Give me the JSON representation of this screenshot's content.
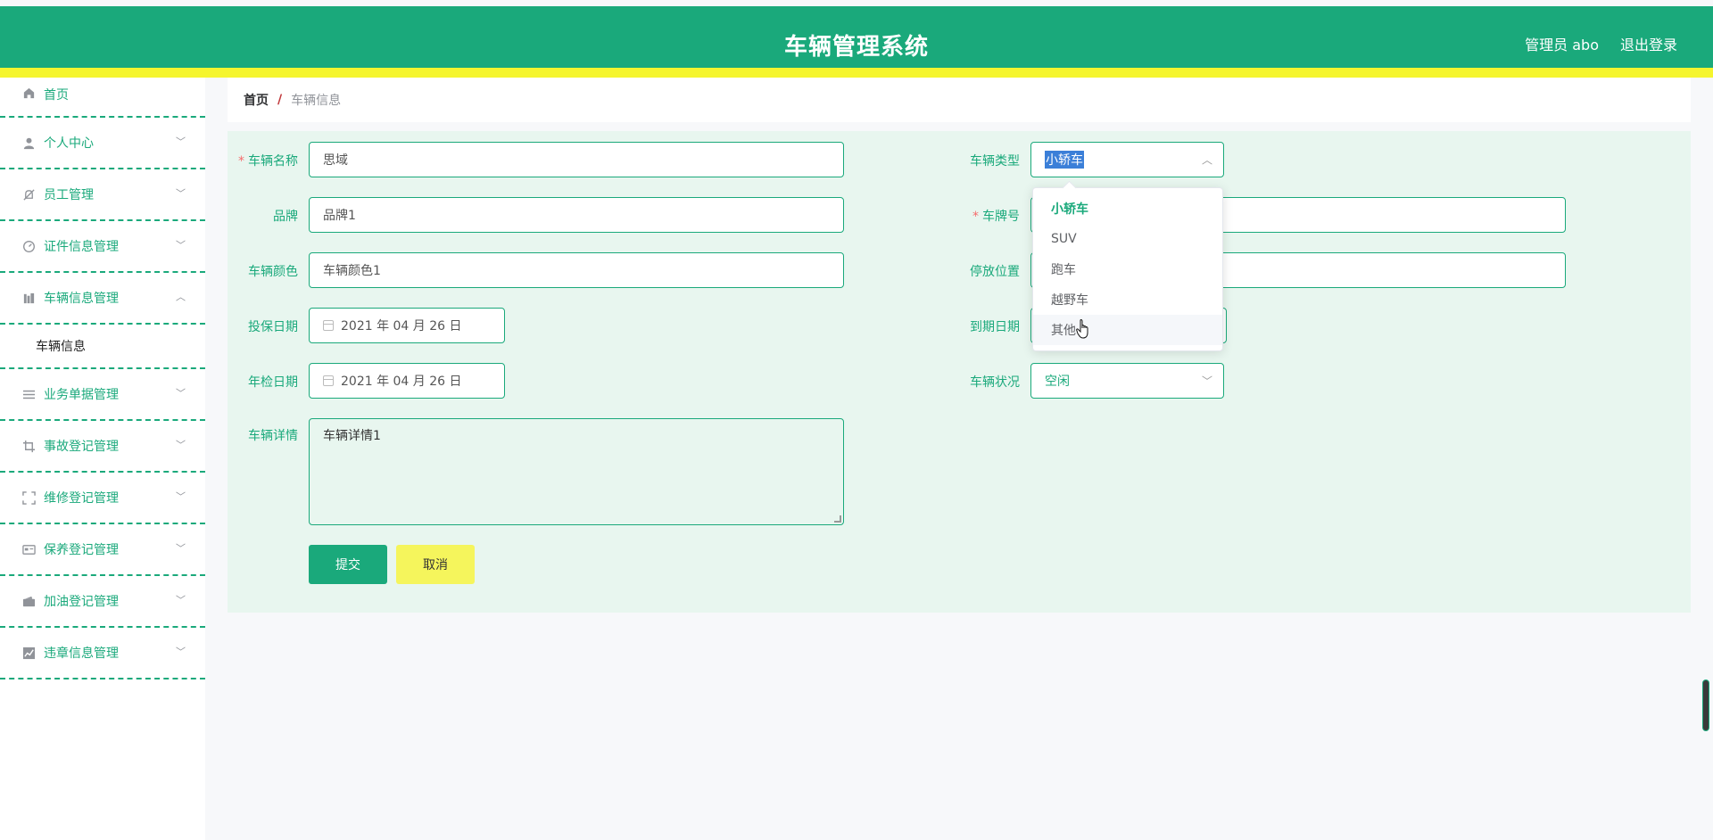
{
  "header": {
    "title": "车辆管理系统",
    "user": "管理员 abo",
    "logout": "退出登录"
  },
  "sidebar": {
    "items": [
      {
        "label": "首页",
        "icon": "home-icon"
      },
      {
        "label": "个人中心",
        "icon": "user-icon"
      },
      {
        "label": "员工管理",
        "icon": "bell-off-icon"
      },
      {
        "label": "证件信息管理",
        "icon": "gauge-icon"
      },
      {
        "label": "车辆信息管理",
        "icon": "building-icon"
      },
      {
        "label": "业务单据管理",
        "icon": "list-icon"
      },
      {
        "label": "事故登记管理",
        "icon": "crop-icon"
      },
      {
        "label": "维修登记管理",
        "icon": "fullscreen-icon"
      },
      {
        "label": "保养登记管理",
        "icon": "id-card-icon"
      },
      {
        "label": "加油登记管理",
        "icon": "wallet-icon"
      },
      {
        "label": "违章信息管理",
        "icon": "chart-icon"
      }
    ],
    "submenu": {
      "label": "车辆信息"
    }
  },
  "breadcrumb": {
    "home": "首页",
    "separator": "/",
    "current": "车辆信息"
  },
  "form": {
    "vehicle_name": {
      "label": "车辆名称",
      "value": "思域",
      "required": "*"
    },
    "brand": {
      "label": "品牌",
      "value": "品牌1"
    },
    "color": {
      "label": "车辆颜色",
      "value": "车辆颜色1"
    },
    "insure_date": {
      "label": "投保日期",
      "value": "2021 年 04 月 26 日"
    },
    "inspect_date": {
      "label": "年检日期",
      "value": "2021 年 04 月 26 日"
    },
    "details": {
      "label": "车辆详情",
      "value": "车辆详情1"
    },
    "vehicle_type": {
      "label": "车辆类型",
      "value": "小轿车"
    },
    "plate": {
      "label": "车牌号",
      "required": "*"
    },
    "parking": {
      "label": "停放位置"
    },
    "expire_date": {
      "label": "到期日期"
    },
    "status": {
      "label": "车辆状况",
      "value": "空闲"
    },
    "submit": "提交",
    "cancel": "取消"
  },
  "dropdown": {
    "options": [
      "小轿车",
      "SUV",
      "跑车",
      "越野车",
      "其他"
    ],
    "selected": "小轿车",
    "hovered": "其他"
  },
  "colors": {
    "primary": "#1aa97b",
    "accent": "#f5f52e",
    "form_bg": "#e8f6ef"
  }
}
